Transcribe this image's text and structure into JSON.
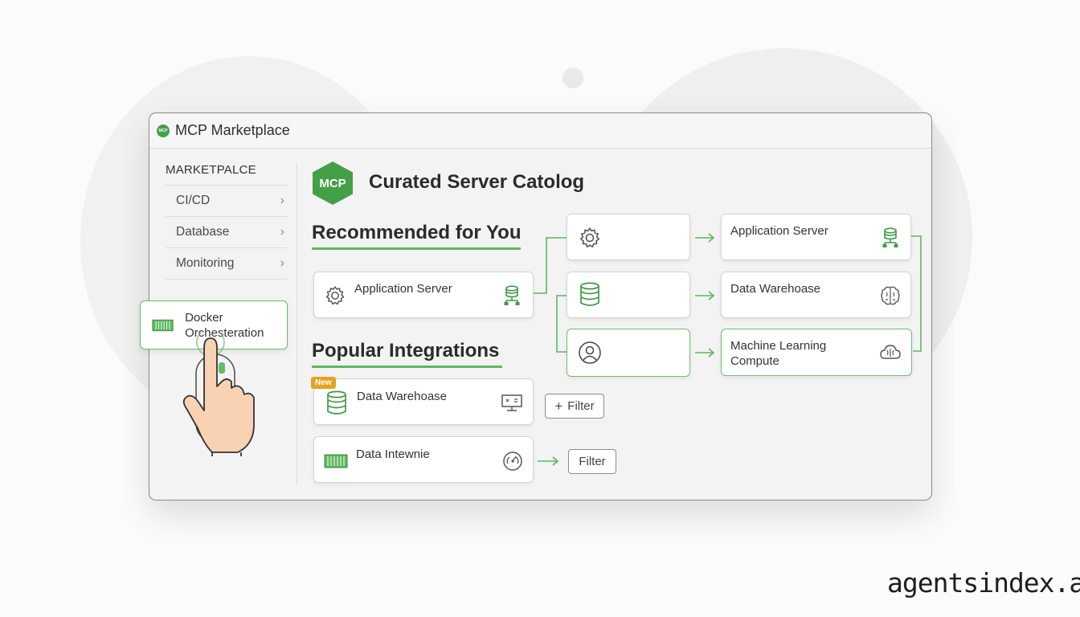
{
  "window": {
    "title": "MCP Marketplace",
    "logo_text": "MCP"
  },
  "sidebar": {
    "heading": "MARKETPALCE",
    "items": [
      {
        "label": "CI/CD"
      },
      {
        "label": "Database"
      },
      {
        "label": "Monitoring"
      }
    ],
    "active_item": {
      "label": "Docker Orchesteration"
    }
  },
  "main": {
    "logo_text": "MCP",
    "title": "Curated Server Catolog",
    "recommended": {
      "title": "Recommended for You",
      "card": {
        "label": "Application Server"
      }
    },
    "popular": {
      "title": "Popular Integrations",
      "cards": [
        {
          "label": "Data Warehoase",
          "badge": "New"
        },
        {
          "label": "Data Intewnie"
        }
      ],
      "filter_1": "Filter",
      "filter_2": "Filter"
    },
    "flow": {
      "targets": [
        {
          "label": "Application Server"
        },
        {
          "label": "Data Warehoase"
        },
        {
          "label": "Machine Learning\nCompute"
        }
      ]
    }
  },
  "brand": "agentsindex.ai",
  "colors": {
    "accent": "#43a047",
    "badge": "#e6a21f"
  }
}
